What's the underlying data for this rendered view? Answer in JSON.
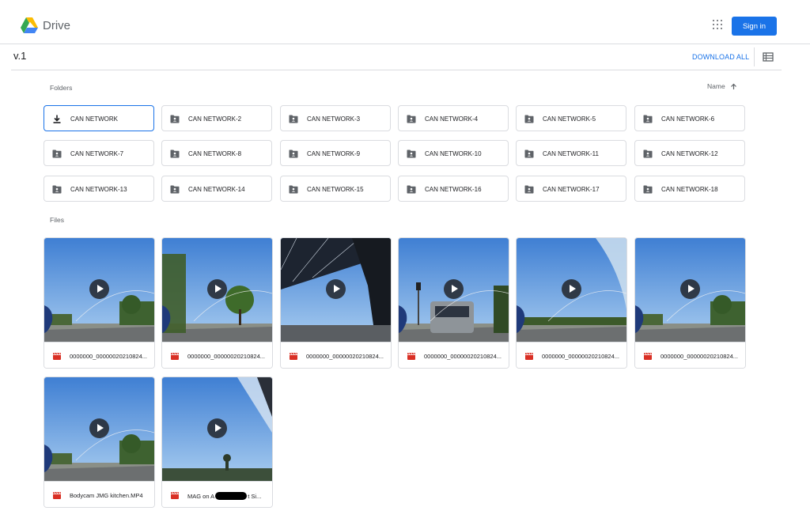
{
  "header": {
    "brand": "Drive",
    "apps_icon": "apps-grid-icon",
    "sign_in": "Sign in"
  },
  "toolbar": {
    "title": "v.1",
    "download_all": "DOWNLOAD ALL",
    "view_icon": "list-view-icon"
  },
  "folders": {
    "label": "Folders",
    "sort_label": "Name",
    "sort_icon": "arrow-up-icon",
    "items": [
      {
        "name": "CAN NETWORK",
        "icon": "download-icon"
      },
      {
        "name": "CAN NETWORK-2",
        "icon": "shared-folder-icon"
      },
      {
        "name": "CAN NETWORK-3",
        "icon": "shared-folder-icon"
      },
      {
        "name": "CAN NETWORK-4",
        "icon": "shared-folder-icon"
      },
      {
        "name": "CAN NETWORK-5",
        "icon": "shared-folder-icon"
      },
      {
        "name": "CAN NETWORK-6",
        "icon": "shared-folder-icon"
      },
      {
        "name": "CAN NETWORK-7",
        "icon": "shared-folder-icon"
      },
      {
        "name": "CAN NETWORK-8",
        "icon": "shared-folder-icon"
      },
      {
        "name": "CAN NETWORK-9",
        "icon": "shared-folder-icon"
      },
      {
        "name": "CAN NETWORK-10",
        "icon": "shared-folder-icon"
      },
      {
        "name": "CAN NETWORK-11",
        "icon": "shared-folder-icon"
      },
      {
        "name": "CAN NETWORK-12",
        "icon": "shared-folder-icon"
      },
      {
        "name": "CAN NETWORK-13",
        "icon": "shared-folder-icon"
      },
      {
        "name": "CAN NETWORK-14",
        "icon": "shared-folder-icon"
      },
      {
        "name": "CAN NETWORK-15",
        "icon": "shared-folder-icon"
      },
      {
        "name": "CAN NETWORK-16",
        "icon": "shared-folder-icon"
      },
      {
        "name": "CAN NETWORK-17",
        "icon": "shared-folder-icon"
      },
      {
        "name": "CAN NETWORK-18",
        "icon": "shared-folder-icon"
      }
    ]
  },
  "files": {
    "label": "Files",
    "items": [
      {
        "name": "0000000_00000020210824...",
        "icon": "video-file-icon"
      },
      {
        "name": "0000000_00000020210824...",
        "icon": "video-file-icon"
      },
      {
        "name": "0000000_00000020210824...",
        "icon": "video-file-icon"
      },
      {
        "name": "0000000_00000020210824...",
        "icon": "video-file-icon"
      },
      {
        "name": "0000000_00000020210824...",
        "icon": "video-file-icon"
      },
      {
        "name": "0000000_00000020210824...",
        "icon": "video-file-icon"
      },
      {
        "name": "Bodycam JMG kitchen.MP4",
        "icon": "video-file-icon"
      },
      {
        "name": "MAG on A",
        "name_suffix": "t Si...",
        "icon": "video-file-icon"
      }
    ]
  },
  "colors": {
    "accent": "#1a73e8",
    "border": "#dadce0",
    "video_icon": "#d93025",
    "sky": "#4a90d9"
  }
}
